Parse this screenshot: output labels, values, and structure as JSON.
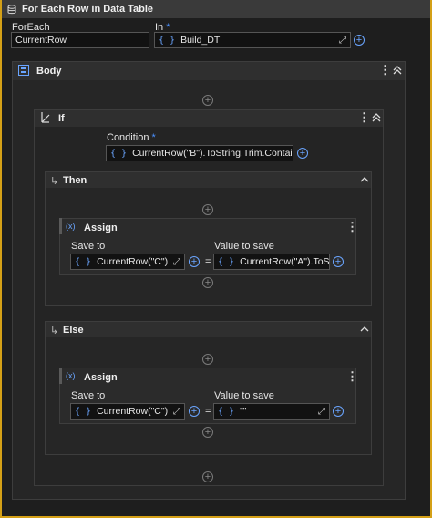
{
  "title": "For Each Row in Data Table",
  "foreach": {
    "label": "ForEach",
    "value": "CurrentRow"
  },
  "in": {
    "label": "In",
    "required": "*",
    "value": "Build_DT"
  },
  "body": {
    "label": "Body"
  },
  "if": {
    "label": "If",
    "condition_label": "Condition",
    "condition_required": "*",
    "condition_value": "CurrentRow(\"B\").ToString.Trim.Contains(\"S\"",
    "then": {
      "label": "Then",
      "assign": {
        "label": "Assign",
        "save_to_label": "Save to",
        "value_label": "Value to save",
        "save_to": "CurrentRow(\"C\")",
        "value": "CurrentRow(\"A\").ToStri",
        "equals": "="
      }
    },
    "else": {
      "label": "Else",
      "assign": {
        "label": "Assign",
        "save_to_label": "Save to",
        "value_label": "Value to save",
        "save_to": "CurrentRow(\"C\")",
        "value": "\"\"",
        "equals": "="
      }
    }
  },
  "icons": {
    "curly": "{ }",
    "plus": "+",
    "add": "+",
    "kebab": "⋮",
    "expand": "⤢",
    "collapse": "^"
  }
}
